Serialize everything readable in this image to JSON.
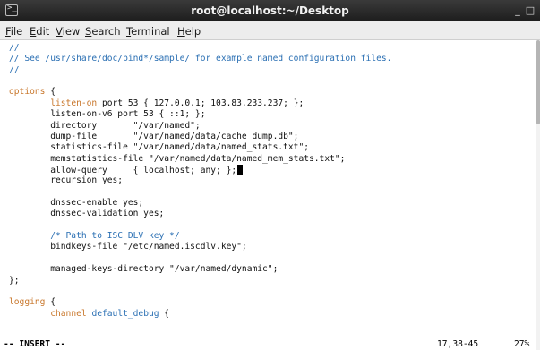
{
  "window": {
    "title": "root@localhost:~/Desktop",
    "icon": "terminal-icon",
    "minimize_glyph": "_",
    "maximize_glyph": "□"
  },
  "menu": [
    {
      "accel": "F",
      "rest": "ile"
    },
    {
      "accel": "E",
      "rest": "dit"
    },
    {
      "accel": "V",
      "rest": "iew"
    },
    {
      "accel": "S",
      "rest": "earch"
    },
    {
      "accel": "T",
      "rest": "erminal"
    },
    {
      "accel": "H",
      "rest": "elp"
    }
  ],
  "colors": {
    "comment": "#2a6fb3",
    "keyword": "#c8762a",
    "text": "#111111"
  },
  "editor": {
    "lines": [
      [
        {
          "t": "//",
          "s": "c"
        }
      ],
      [
        {
          "t": "// See /usr/share/doc/bind*/sample/ for example named configuration files.",
          "s": "c"
        }
      ],
      [
        {
          "t": "//",
          "s": "c"
        }
      ],
      [],
      [
        {
          "t": "options",
          "s": "kw"
        },
        {
          "t": " {",
          "s": ""
        }
      ],
      [
        {
          "t": "        ",
          "s": ""
        },
        {
          "t": "listen-on",
          "s": "kw"
        },
        {
          "t": " port 53 { 127.0.0.1; 103.83.233.237; };",
          "s": ""
        }
      ],
      [
        {
          "t": "        listen-on-v6 port 53 { ::1; };",
          "s": ""
        }
      ],
      [
        {
          "t": "        directory       \"/var/named\";",
          "s": ""
        }
      ],
      [
        {
          "t": "        dump-file       \"/var/named/data/cache_dump.db\";",
          "s": ""
        }
      ],
      [
        {
          "t": "        statistics-file \"/var/named/data/named_stats.txt\";",
          "s": ""
        }
      ],
      [
        {
          "t": "        memstatistics-file \"/var/named/data/named_mem_stats.txt\";",
          "s": ""
        }
      ],
      [
        {
          "t": "        allow-query     { localhost; any; };",
          "s": ""
        },
        {
          "t": "",
          "s": "cursor"
        }
      ],
      [
        {
          "t": "        recursion yes;",
          "s": ""
        }
      ],
      [],
      [
        {
          "t": "        dnssec-enable yes;",
          "s": ""
        }
      ],
      [
        {
          "t": "        dnssec-validation yes;",
          "s": ""
        }
      ],
      [],
      [
        {
          "t": "        /* Path to ISC DLV key */",
          "s": "c"
        }
      ],
      [
        {
          "t": "        bindkeys-file \"/etc/named.iscdlv.key\";",
          "s": ""
        }
      ],
      [],
      [
        {
          "t": "        managed-keys-directory \"/var/named/dynamic\";",
          "s": ""
        }
      ],
      [
        {
          "t": "};",
          "s": ""
        }
      ],
      [],
      [
        {
          "t": "logging",
          "s": "kw"
        },
        {
          "t": " {",
          "s": ""
        }
      ],
      [
        {
          "t": "        ",
          "s": ""
        },
        {
          "t": "channel",
          "s": "kw"
        },
        {
          "t": " ",
          "s": ""
        },
        {
          "t": "default_debug",
          "s": "c"
        },
        {
          "t": " {",
          "s": ""
        }
      ]
    ]
  },
  "status": {
    "mode": "-- INSERT --",
    "position": "17,38-45",
    "percent": "27%"
  }
}
